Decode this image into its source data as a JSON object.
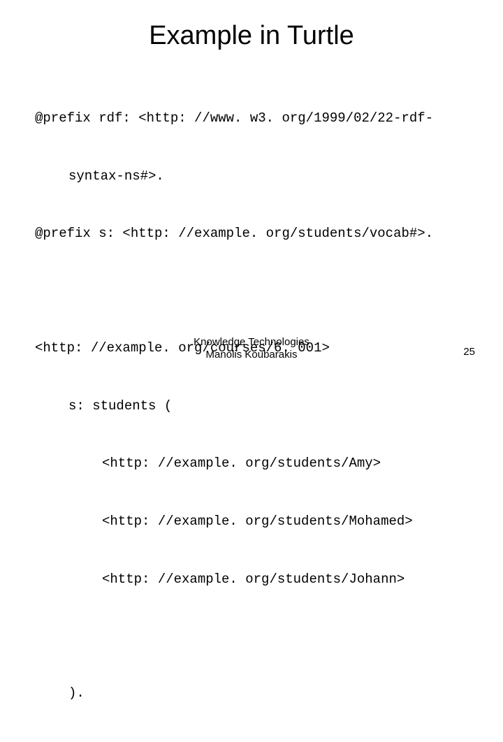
{
  "title": "Example in Turtle",
  "code": {
    "line1a": "@prefix rdf: <http: //www. w3. org/1999/02/22-rdf-",
    "line1b": "syntax-ns#>.",
    "line2": "@prefix s: <http: //example. org/students/vocab#>.",
    "line3": "<http: //example. org/courses/6. 001>",
    "line4": "s: students (",
    "line5": "<http: //example. org/students/Amy>",
    "line6": "<http: //example. org/students/Mohamed>",
    "line7": "<http: //example. org/students/Johann>",
    "line8": ")."
  },
  "footer": {
    "line1": "Knowledge Technologies",
    "line2": "Manolis Koubarakis"
  },
  "page_number": "25"
}
